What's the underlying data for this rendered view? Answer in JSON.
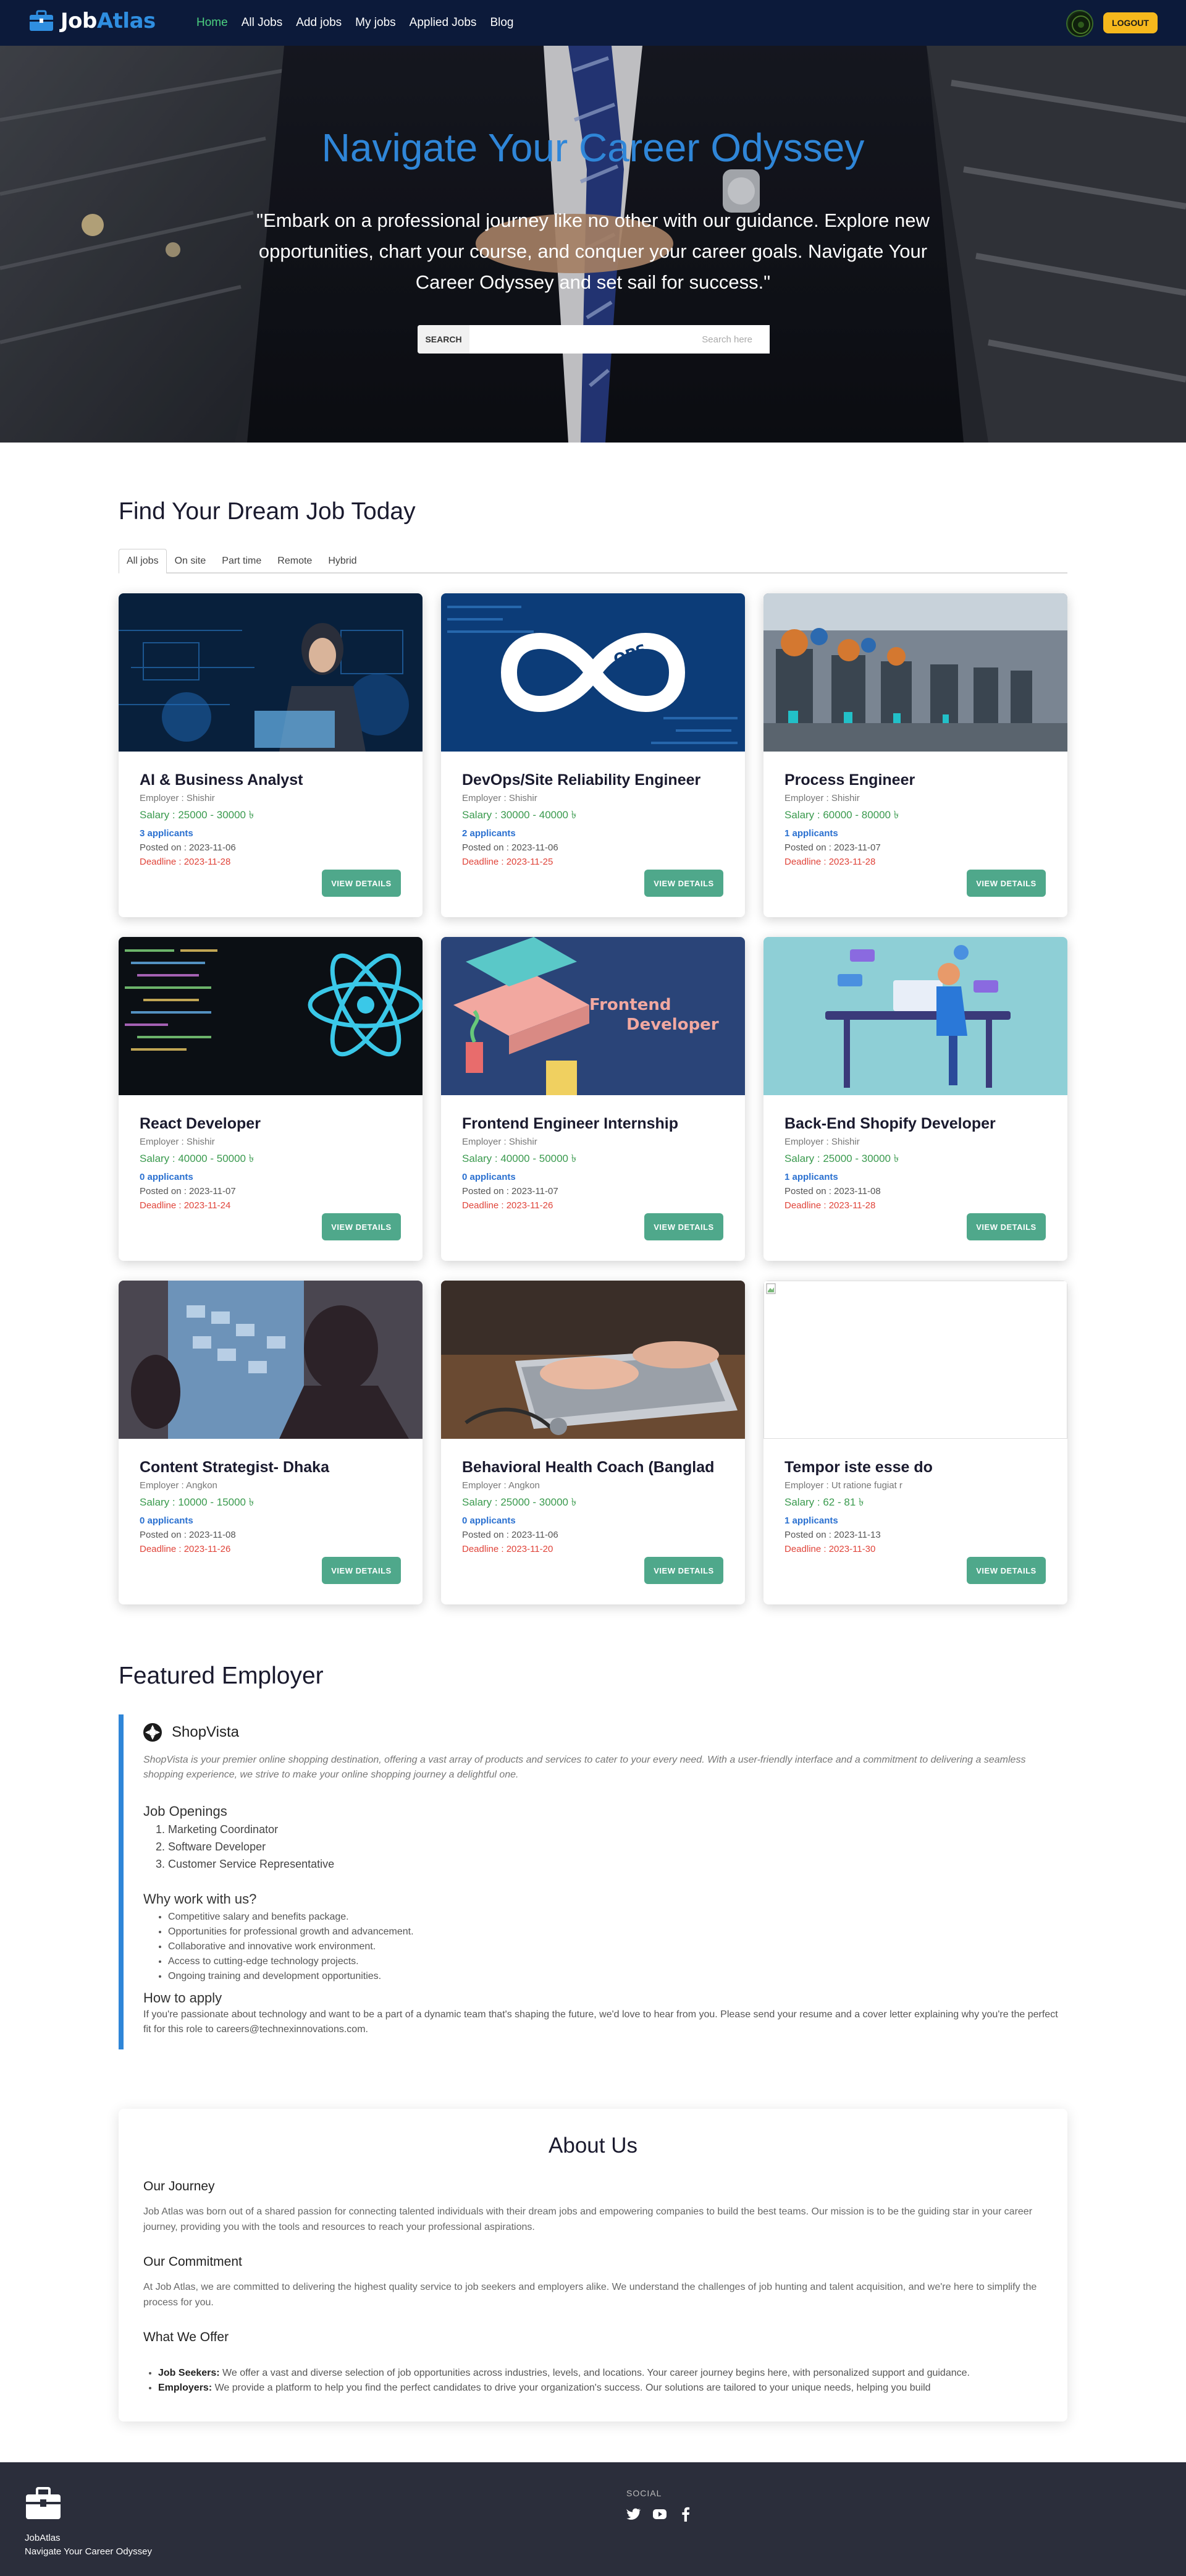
{
  "navbar": {
    "brand_part1": "Job",
    "brand_part2": "Atlas",
    "links": [
      "Home",
      "All Jobs",
      "Add jobs",
      "My jobs",
      "Applied Jobs",
      "Blog"
    ],
    "active_link": "Home",
    "logout_label": "LOGOUT",
    "accent_color": "#4cd080",
    "logout_color": "#f6b81c"
  },
  "hero": {
    "title": "Navigate Your Career Odyssey",
    "subtitle": "\"Embark on a professional journey like no other with our guidance. Explore new opportunities, chart your course, and conquer your career goals. Navigate Your Career Odyssey and set sail for success.\"",
    "search_label": "SEARCH",
    "search_placeholder": "Search here"
  },
  "jobs_section": {
    "title": "Find Your Dream Job Today",
    "tabs": [
      "All jobs",
      "On site",
      "Part time",
      "Remote",
      "Hybrid"
    ],
    "active_tab": "All jobs",
    "view_details_label": "VIEW DETAILS",
    "jobs": [
      {
        "title": "AI & Business Analyst",
        "employer": "Employer : Shishir",
        "salary": "Salary : 25000 - 30000 ৳",
        "applicants": "3 applicants",
        "posted": "Posted on : 2023-11-06",
        "deadline": "Deadline : 2023-11-28",
        "image": "ai-analyst-image"
      },
      {
        "title": "DevOps/Site Reliability Engineer",
        "employer": "Employer : Shishir",
        "salary": "Salary : 30000 - 40000 ৳",
        "applicants": "2 applicants",
        "posted": "Posted on : 2023-11-06",
        "deadline": "Deadline : 2023-11-25",
        "image": "devops-image"
      },
      {
        "title": "Process Engineer",
        "employer": "Employer : Shishir",
        "salary": "Salary : 60000 - 80000 ৳",
        "applicants": "1 applicants",
        "posted": "Posted on : 2023-11-07",
        "deadline": "Deadline : 2023-11-28",
        "image": "factory-image"
      },
      {
        "title": "React Developer",
        "employer": "Employer : Shishir",
        "salary": "Salary : 40000 - 50000 ৳",
        "applicants": "0 applicants",
        "posted": "Posted on : 2023-11-07",
        "deadline": "Deadline : 2023-11-24",
        "image": "react-code-image"
      },
      {
        "title": "Frontend Engineer Internship",
        "employer": "Employer : Shishir",
        "salary": "Salary : 40000 - 50000 ৳",
        "applicants": "0 applicants",
        "posted": "Posted on : 2023-11-07",
        "deadline": "Deadline : 2023-11-26",
        "image": "frontend-illustration",
        "image_text_1": "Frontend",
        "image_text_2": "Developer"
      },
      {
        "title": "Back-End Shopify Developer",
        "employer": "Employer : Shishir",
        "salary": "Salary : 25000 - 30000 ৳",
        "applicants": "1 applicants",
        "posted": "Posted on : 2023-11-08",
        "deadline": "Deadline : 2023-11-28",
        "image": "backend-illustration"
      },
      {
        "title": "Content Strategist- Dhaka",
        "employer": "Employer : Angkon",
        "salary": "Salary : 10000 - 15000 ৳",
        "applicants": "0 applicants",
        "posted": "Posted on : 2023-11-08",
        "deadline": "Deadline : 2023-11-26",
        "image": "strategy-image"
      },
      {
        "title": "Behavioral Health Coach (Banglad",
        "employer": "Employer : Angkon",
        "salary": "Salary : 25000 - 30000 ৳",
        "applicants": "0 applicants",
        "posted": "Posted on : 2023-11-06",
        "deadline": "Deadline : 2023-11-20",
        "image": "laptop-typing-image"
      },
      {
        "title": "Tempor iste esse do",
        "employer": "Employer : Ut ratione fugiat r",
        "salary": "Salary : 62 - 81 ৳",
        "applicants": "1 applicants",
        "posted": "Posted on : 2023-11-13",
        "deadline": "Deadline : 2023-11-30",
        "image": "broken-image"
      }
    ]
  },
  "featured": {
    "title": "Featured Employer",
    "employer_name": "ShopVista",
    "description": "ShopVista is your premier online shopping destination, offering a vast array of products and services to cater to your every need. With a user-friendly interface and a commitment to delivering a seamless shopping experience, we strive to make your online shopping journey a delightful one.",
    "openings_title": "Job Openings",
    "openings": [
      "Marketing Coordinator",
      "Software Developer",
      "Customer Service Representative"
    ],
    "why_title": "Why work with us?",
    "why_items": [
      "Competitive salary and benefits package.",
      "Opportunities for professional growth and advancement.",
      "Collaborative and innovative work environment.",
      "Access to cutting-edge technology projects.",
      "Ongoing training and development opportunities."
    ],
    "apply_title": "How to apply",
    "apply_text": "If you're passionate about technology and want to be a part of a dynamic team that's shaping the future, we'd love to hear from you. Please send your resume and a cover letter explaining why you're the perfect fit for this role to careers@technexinnovations.com."
  },
  "about": {
    "title": "About Us",
    "journey_title": "Our Journey",
    "journey_text": "Job Atlas was born out of a shared passion for connecting talented individuals with their dream jobs and empowering companies to build the best teams. Our mission is to be the guiding star in your career journey, providing you with the tools and resources to reach your professional aspirations.",
    "commitment_title": "Our Commitment",
    "commitment_text": "At Job Atlas, we are committed to delivering the highest quality service to job seekers and employers alike. We understand the challenges of job hunting and talent acquisition, and we're here to simplify the process for you.",
    "offer_title": "What We Offer",
    "offers": [
      {
        "label": "Job Seekers:",
        "text": " We offer a vast and diverse selection of job opportunities across industries, levels, and locations. Your career journey begins here, with personalized support and guidance."
      },
      {
        "label": "Employers:",
        "text": " We provide a platform to help you find the perfect candidates to drive your organization's success. Our solutions are tailored to your unique needs, helping you build"
      }
    ]
  },
  "footer": {
    "brand": "JobAtlas",
    "tagline": "Navigate Your Career Odyssey",
    "social_label": "SOCIAL",
    "social_icons": [
      "twitter-icon",
      "youtube-icon",
      "facebook-icon"
    ]
  }
}
